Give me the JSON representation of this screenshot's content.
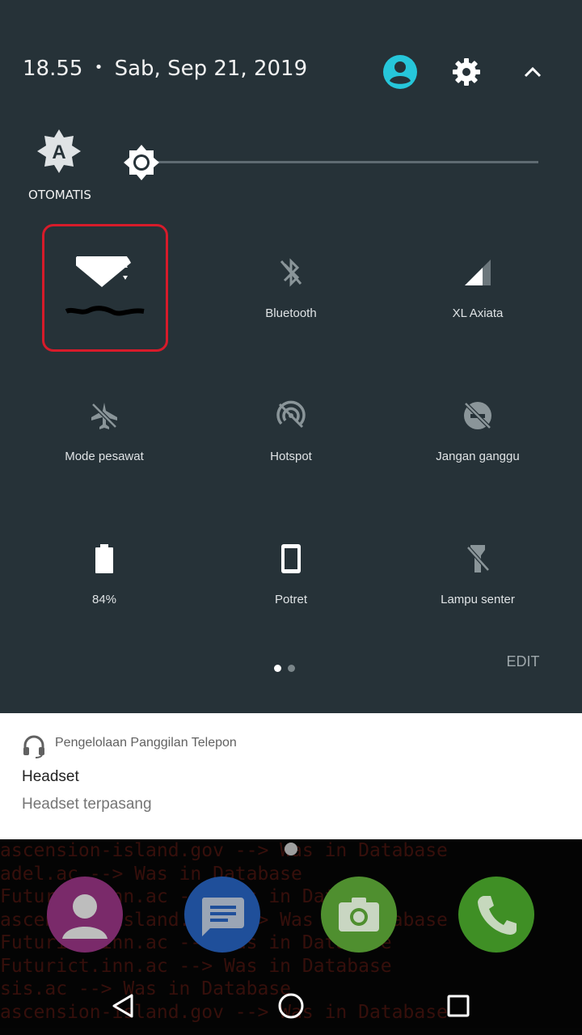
{
  "header": {
    "time": "18.55",
    "separator": "•",
    "date": "Sab, Sep 21, 2019",
    "user_icon": "account-circle-icon",
    "settings_icon": "gear-icon",
    "collapse_icon": "chevron-up-icon"
  },
  "brightness": {
    "auto_label": "OTOMATIS",
    "auto_icon": "brightness-auto-icon",
    "level": 0.0
  },
  "tiles": [
    {
      "label": "",
      "icon": "wifi-icon",
      "active": true
    },
    {
      "label": "Bluetooth",
      "icon": "bluetooth-disabled-icon",
      "active": false
    },
    {
      "label": "XL Axiata",
      "icon": "cellular-signal-icon",
      "active": true
    },
    {
      "label": "Mode pesawat",
      "icon": "airplane-off-icon",
      "active": false
    },
    {
      "label": "Hotspot",
      "icon": "hotspot-off-icon",
      "active": false
    },
    {
      "label": "Jangan ganggu",
      "icon": "do-not-disturb-off-icon",
      "active": false
    },
    {
      "label": "84%",
      "icon": "battery-icon",
      "active": true
    },
    {
      "label": "Potret",
      "icon": "portrait-orientation-icon",
      "active": true
    },
    {
      "label": "Lampu senter",
      "icon": "flashlight-off-icon",
      "active": false
    }
  ],
  "pager": {
    "pages": 2,
    "current": 1
  },
  "edit_label": "EDIT",
  "notification": {
    "app_name": "Pengelolaan Panggilan Telepon",
    "app_icon": "headset-icon",
    "title": "Headset",
    "body": "Headset terpasang"
  },
  "wallpaper_lines": [
    "ascension-island.gov --> Was in Database",
    "adel.ac --> Was in Database",
    "Futurict.inn.ac --> Was in Database",
    "ascension-island.gov --> Was in Database",
    "Futurict.inn.ac --> Was in Database",
    "Futurict.inn.ac --> Was in Database",
    "sis.ac --> Was in Database",
    "ascension-island.gov --> Was in Database"
  ],
  "dock": [
    {
      "icon": "contacts-icon",
      "color": "#7a2a6a"
    },
    {
      "icon": "messages-icon",
      "color": "#1f4f9a"
    },
    {
      "icon": "camera-icon",
      "color": "#4f8f2f"
    },
    {
      "icon": "phone-icon",
      "color": "#3f8f25"
    }
  ],
  "navbar": {
    "back": "back-icon",
    "home": "home-icon",
    "recents": "recents-icon"
  },
  "colors": {
    "panel": "#263238",
    "highlight": "#d71b2a",
    "accent": "#26c6da"
  }
}
